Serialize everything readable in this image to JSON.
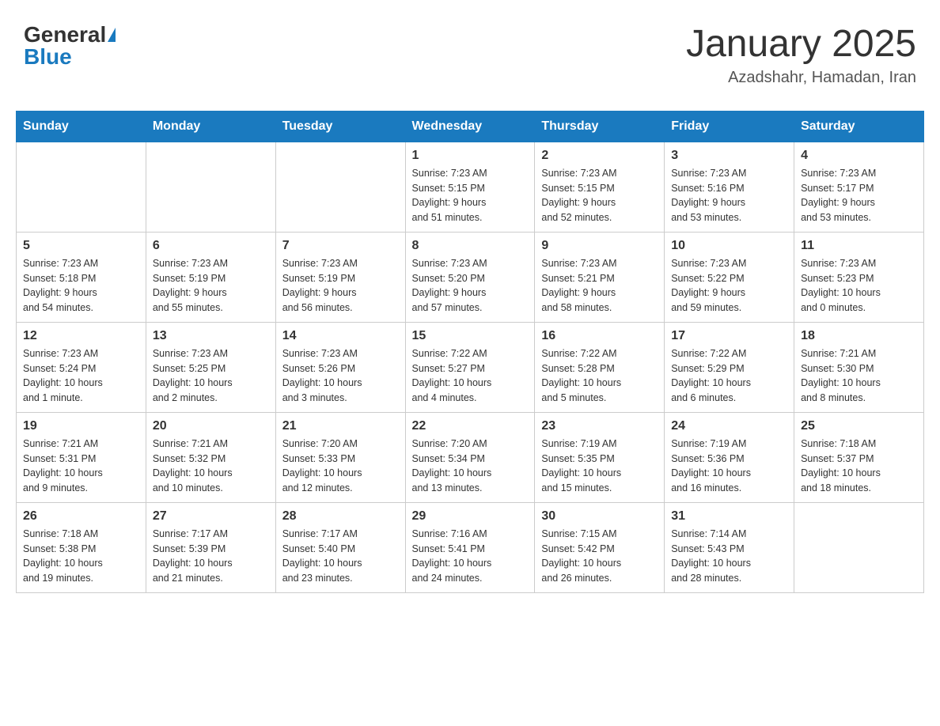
{
  "header": {
    "logo_general": "General",
    "logo_blue": "Blue",
    "month_title": "January 2025",
    "location": "Azadshahr, Hamadan, Iran"
  },
  "days_of_week": [
    "Sunday",
    "Monday",
    "Tuesday",
    "Wednesday",
    "Thursday",
    "Friday",
    "Saturday"
  ],
  "weeks": [
    [
      {
        "day": "",
        "info": ""
      },
      {
        "day": "",
        "info": ""
      },
      {
        "day": "",
        "info": ""
      },
      {
        "day": "1",
        "info": "Sunrise: 7:23 AM\nSunset: 5:15 PM\nDaylight: 9 hours\nand 51 minutes."
      },
      {
        "day": "2",
        "info": "Sunrise: 7:23 AM\nSunset: 5:15 PM\nDaylight: 9 hours\nand 52 minutes."
      },
      {
        "day": "3",
        "info": "Sunrise: 7:23 AM\nSunset: 5:16 PM\nDaylight: 9 hours\nand 53 minutes."
      },
      {
        "day": "4",
        "info": "Sunrise: 7:23 AM\nSunset: 5:17 PM\nDaylight: 9 hours\nand 53 minutes."
      }
    ],
    [
      {
        "day": "5",
        "info": "Sunrise: 7:23 AM\nSunset: 5:18 PM\nDaylight: 9 hours\nand 54 minutes."
      },
      {
        "day": "6",
        "info": "Sunrise: 7:23 AM\nSunset: 5:19 PM\nDaylight: 9 hours\nand 55 minutes."
      },
      {
        "day": "7",
        "info": "Sunrise: 7:23 AM\nSunset: 5:19 PM\nDaylight: 9 hours\nand 56 minutes."
      },
      {
        "day": "8",
        "info": "Sunrise: 7:23 AM\nSunset: 5:20 PM\nDaylight: 9 hours\nand 57 minutes."
      },
      {
        "day": "9",
        "info": "Sunrise: 7:23 AM\nSunset: 5:21 PM\nDaylight: 9 hours\nand 58 minutes."
      },
      {
        "day": "10",
        "info": "Sunrise: 7:23 AM\nSunset: 5:22 PM\nDaylight: 9 hours\nand 59 minutes."
      },
      {
        "day": "11",
        "info": "Sunrise: 7:23 AM\nSunset: 5:23 PM\nDaylight: 10 hours\nand 0 minutes."
      }
    ],
    [
      {
        "day": "12",
        "info": "Sunrise: 7:23 AM\nSunset: 5:24 PM\nDaylight: 10 hours\nand 1 minute."
      },
      {
        "day": "13",
        "info": "Sunrise: 7:23 AM\nSunset: 5:25 PM\nDaylight: 10 hours\nand 2 minutes."
      },
      {
        "day": "14",
        "info": "Sunrise: 7:23 AM\nSunset: 5:26 PM\nDaylight: 10 hours\nand 3 minutes."
      },
      {
        "day": "15",
        "info": "Sunrise: 7:22 AM\nSunset: 5:27 PM\nDaylight: 10 hours\nand 4 minutes."
      },
      {
        "day": "16",
        "info": "Sunrise: 7:22 AM\nSunset: 5:28 PM\nDaylight: 10 hours\nand 5 minutes."
      },
      {
        "day": "17",
        "info": "Sunrise: 7:22 AM\nSunset: 5:29 PM\nDaylight: 10 hours\nand 6 minutes."
      },
      {
        "day": "18",
        "info": "Sunrise: 7:21 AM\nSunset: 5:30 PM\nDaylight: 10 hours\nand 8 minutes."
      }
    ],
    [
      {
        "day": "19",
        "info": "Sunrise: 7:21 AM\nSunset: 5:31 PM\nDaylight: 10 hours\nand 9 minutes."
      },
      {
        "day": "20",
        "info": "Sunrise: 7:21 AM\nSunset: 5:32 PM\nDaylight: 10 hours\nand 10 minutes."
      },
      {
        "day": "21",
        "info": "Sunrise: 7:20 AM\nSunset: 5:33 PM\nDaylight: 10 hours\nand 12 minutes."
      },
      {
        "day": "22",
        "info": "Sunrise: 7:20 AM\nSunset: 5:34 PM\nDaylight: 10 hours\nand 13 minutes."
      },
      {
        "day": "23",
        "info": "Sunrise: 7:19 AM\nSunset: 5:35 PM\nDaylight: 10 hours\nand 15 minutes."
      },
      {
        "day": "24",
        "info": "Sunrise: 7:19 AM\nSunset: 5:36 PM\nDaylight: 10 hours\nand 16 minutes."
      },
      {
        "day": "25",
        "info": "Sunrise: 7:18 AM\nSunset: 5:37 PM\nDaylight: 10 hours\nand 18 minutes."
      }
    ],
    [
      {
        "day": "26",
        "info": "Sunrise: 7:18 AM\nSunset: 5:38 PM\nDaylight: 10 hours\nand 19 minutes."
      },
      {
        "day": "27",
        "info": "Sunrise: 7:17 AM\nSunset: 5:39 PM\nDaylight: 10 hours\nand 21 minutes."
      },
      {
        "day": "28",
        "info": "Sunrise: 7:17 AM\nSunset: 5:40 PM\nDaylight: 10 hours\nand 23 minutes."
      },
      {
        "day": "29",
        "info": "Sunrise: 7:16 AM\nSunset: 5:41 PM\nDaylight: 10 hours\nand 24 minutes."
      },
      {
        "day": "30",
        "info": "Sunrise: 7:15 AM\nSunset: 5:42 PM\nDaylight: 10 hours\nand 26 minutes."
      },
      {
        "day": "31",
        "info": "Sunrise: 7:14 AM\nSunset: 5:43 PM\nDaylight: 10 hours\nand 28 minutes."
      },
      {
        "day": "",
        "info": ""
      }
    ]
  ]
}
